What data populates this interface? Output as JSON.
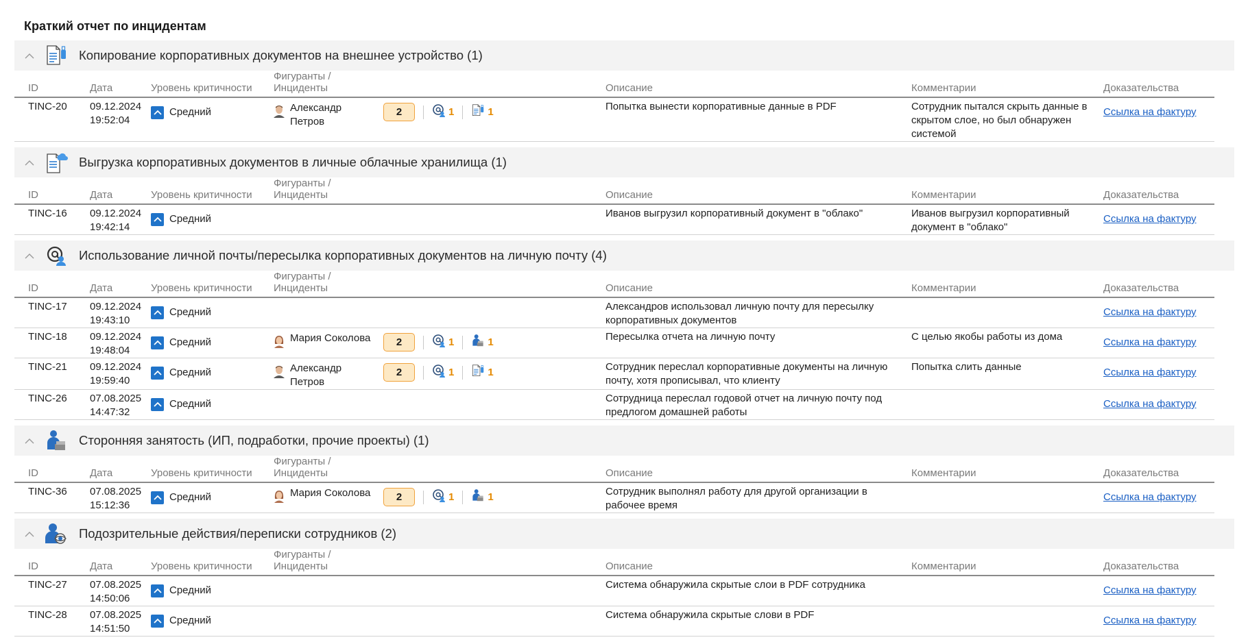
{
  "page_title": "Краткий отчет по инцидентам",
  "columns": {
    "id": "ID",
    "date": "Дата",
    "severity": "Уровень критичности",
    "persons": "Фигуранты / Инциденты",
    "description": "Описание",
    "comments": "Комментарии",
    "evidence": "Доказательства"
  },
  "colors": {
    "accent": "#1f73c9",
    "badge_bg": "#fde9c5",
    "badge_border": "#f0a23c",
    "count": "#e58a00",
    "link": "#1a5fc4"
  },
  "groups": [
    {
      "title": "Копирование корпоративных документов на внешнее устройство (1)",
      "icon": "document-usb-icon",
      "rows": [
        {
          "id": "TINC-20",
          "date": "09.12.2024",
          "time": "19:52:04",
          "severity": "Средний",
          "person_line1": "Александр",
          "person_line2": "Петров",
          "person_icon": "male-avatar-icon",
          "total": "2",
          "count_a": "1",
          "count_b": "1",
          "icon_a": "email-at-icon",
          "icon_b": "document-usb-icon",
          "desc_1": "Попытка вынести корпоративные данные в PDF",
          "desc_2": "",
          "com_1": "Сотрудник пытался скрыть данные в",
          "com_2": "скрытом слое, но был обнаружен",
          "com_3": "системой",
          "evidence": "Ссылка на фактуру"
        }
      ]
    },
    {
      "title": "Выгрузка корпоративных документов в личные облачные хранилища (1)",
      "icon": "document-cloud-icon",
      "rows": [
        {
          "id": "TINC-16",
          "date": "09.12.2024",
          "time": "19:42:14",
          "severity": "Средний",
          "desc_1": "Иванов выгрузил корпоративный документ  в \"облако\"",
          "desc_2": "",
          "com_1": "Иванов выгрузил корпоративный",
          "com_2": "документ  в \"облако\"",
          "evidence": "Ссылка на фактуру"
        }
      ]
    },
    {
      "title": "Использование личной почты/пересылка корпоративных документов на личную почту (4)",
      "icon": "email-user-icon",
      "rows": [
        {
          "id": "TINC-17",
          "date": "09.12.2024",
          "time": "19:43:10",
          "severity": "Средний",
          "desc_1": "Александров использовал личную почту для пересылку",
          "desc_2": "корпоративных документов",
          "com_1": "",
          "evidence": "Ссылка на фактуру"
        },
        {
          "id": "TINC-18",
          "date": "09.12.2024",
          "time": "19:48:04",
          "severity": "Средний",
          "person_line1": "Мария Соколова",
          "person_icon": "female-avatar-icon",
          "total": "2",
          "count_a": "1",
          "count_b": "1",
          "icon_a": "email-at-icon",
          "icon_b": "side-job-icon",
          "desc_1": "Пересылка отчета на личную почту",
          "desc_2": "",
          "com_1": "С целью якобы работы из дома",
          "evidence": "Ссылка на фактуру"
        },
        {
          "id": "TINC-21",
          "date": "09.12.2024",
          "time": "19:59:40",
          "severity": "Средний",
          "person_line1": "Александр",
          "person_line2": "Петров",
          "person_icon": "male-avatar-icon",
          "total": "2",
          "count_a": "1",
          "count_b": "1",
          "icon_a": "email-at-icon",
          "icon_b": "document-usb-icon",
          "desc_1": "Сотрудник переслал корпоративные документы на личную",
          "desc_2": "почту, хотя прописывал, что клиенту",
          "com_1": "Попытка слить данные",
          "evidence": "Ссылка на фактуру"
        },
        {
          "id": "TINC-26",
          "date": "07.08.2025",
          "time": "14:47:32",
          "severity": "Средний",
          "desc_1": "Сотрудница переслал годовой отчет на личную почту под",
          "desc_2": "предлогом домашней работы",
          "com_1": "",
          "evidence": "Ссылка на фактуру"
        }
      ]
    },
    {
      "title": "Сторонняя занятость (ИП, подработки, прочие проекты) (1)",
      "icon": "side-job-icon",
      "rows": [
        {
          "id": "TINC-36",
          "date": "07.08.2025",
          "time": "15:12:36",
          "severity": "Средний",
          "person_line1": "Мария Соколова",
          "person_icon": "female-avatar-icon",
          "total": "2",
          "count_a": "1",
          "count_b": "1",
          "icon_a": "email-at-icon",
          "icon_b": "side-job-icon",
          "desc_1": "Сотрудник выполнял работу для другой организации в",
          "desc_2": "рабочее время",
          "com_1": "",
          "evidence": "Ссылка на фактуру"
        }
      ]
    },
    {
      "title": "Подозрительные действия/переписки сотрудников (2)",
      "icon": "user-watch-icon",
      "rows": [
        {
          "id": "TINC-27",
          "date": "07.08.2025",
          "time": "14:50:06",
          "severity": "Средний",
          "desc_1": "Система обнаружила скрытые слои в PDF сотрудника",
          "desc_2": "",
          "com_1": "",
          "evidence": "Ссылка на фактуру"
        },
        {
          "id": "TINC-28",
          "date": "07.08.2025",
          "time": "14:51:50",
          "severity": "Средний",
          "desc_1": "Система обнаружила скрытые слови в PDF",
          "desc_2": "",
          "com_1": "",
          "evidence": "Ссылка на фактуру"
        }
      ]
    }
  ]
}
